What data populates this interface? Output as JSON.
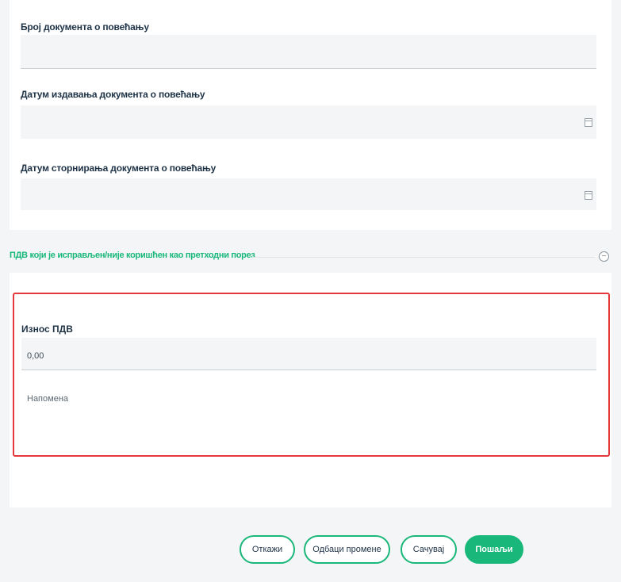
{
  "fields": {
    "document_number": {
      "label": "Број документа о повећању"
    },
    "issue_date": {
      "label": "Датум издавања документа о повећању"
    },
    "cancel_date": {
      "label": "Датум сторнирања документа о повећању"
    }
  },
  "section": {
    "title": "ПДВ који је исправљен/није коришћен као претходни порез"
  },
  "vat": {
    "label": "Износ ПДВ",
    "value": "0,00"
  },
  "note": {
    "placeholder": "Напомена"
  },
  "buttons": {
    "cancel": "Откажи",
    "discard": "Одбаци промене",
    "save": "Сачувај",
    "send": "Пошаљи"
  },
  "colors": {
    "accent": "#19b87a",
    "error_border": "#e5383b"
  }
}
